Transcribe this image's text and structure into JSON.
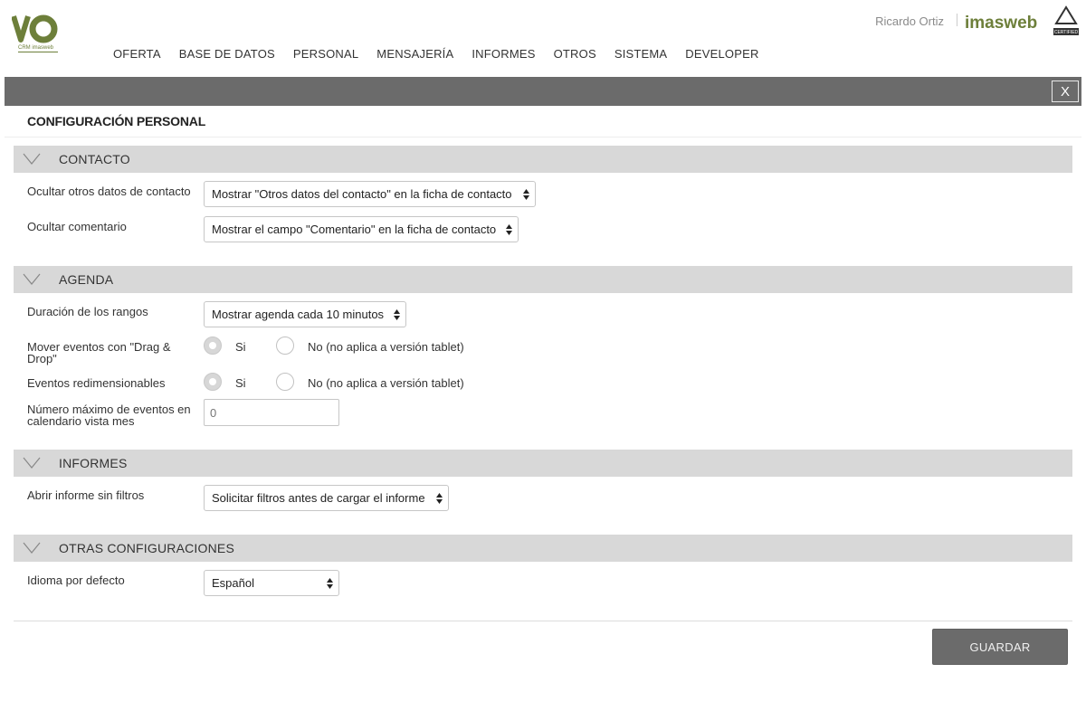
{
  "header": {
    "logo_caption": "CRM imasweb",
    "user_name": "Ricardo Ortiz",
    "brand": "imasweb",
    "cert_text": "CERTIFIED",
    "nav": [
      {
        "label": "OFERTA"
      },
      {
        "label": "BASE DE DATOS"
      },
      {
        "label": "PERSONAL"
      },
      {
        "label": "MENSAJERÍA"
      },
      {
        "label": "INFORMES"
      },
      {
        "label": "OTROS"
      },
      {
        "label": "SISTEMA"
      },
      {
        "label": "DEVELOPER"
      }
    ]
  },
  "titlebar": {
    "close_label": "X"
  },
  "page_title": "CONFIGURACIÓN PERSONAL",
  "sections": {
    "contacto": {
      "title": "CONTACTO",
      "fields": {
        "otros_datos": {
          "label": "Ocultar otros datos de contacto",
          "value": "Mostrar \"Otros datos del contacto\" en la ficha de contacto"
        },
        "comentario": {
          "label": "Ocultar comentario",
          "value": "Mostrar el campo \"Comentario\" en la ficha de contacto"
        }
      }
    },
    "agenda": {
      "title": "AGENDA",
      "fields": {
        "rangos": {
          "label": "Duración de los rangos",
          "value": "Mostrar agenda cada 10 minutos"
        },
        "drag": {
          "label": "Mover eventos con \"Drag & Drop\"",
          "opt_yes": "Si",
          "opt_no": "No (no aplica a versión tablet)",
          "selected": "Si"
        },
        "resize": {
          "label": "Eventos redimensionables",
          "opt_yes": "Si",
          "opt_no": "No (no aplica a versión tablet)",
          "selected": "Si"
        },
        "max_eventos": {
          "label": "Número máximo de eventos en calendario vista mes",
          "placeholder": "0"
        }
      }
    },
    "informes": {
      "title": "INFORMES",
      "fields": {
        "sin_filtros": {
          "label": "Abrir informe sin filtros",
          "value": "Solicitar filtros antes de cargar el informe"
        }
      }
    },
    "otras": {
      "title": "OTRAS CONFIGURACIONES",
      "fields": {
        "idioma": {
          "label": "Idioma por defecto",
          "value": "Español"
        }
      }
    }
  },
  "actions": {
    "save_label": "GUARDAR"
  },
  "colors": {
    "accent_green": "#6d7f3a",
    "bar_gray": "#6b6b6b",
    "section_gray": "#d8d8d8"
  }
}
